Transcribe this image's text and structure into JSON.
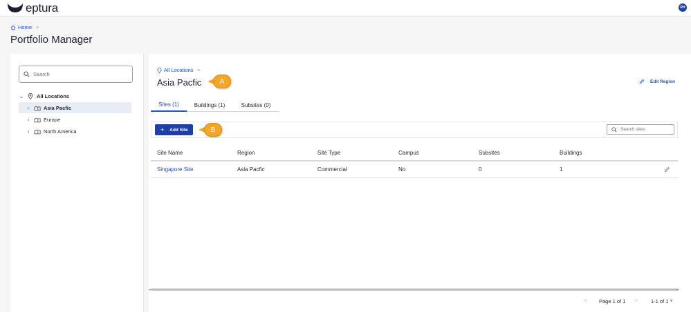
{
  "app": {
    "logo_text": "eptura",
    "avatar_initials": "RH"
  },
  "breadcrumb": {
    "home": "Home",
    "separator": ">"
  },
  "page": {
    "title": "Portfolio Manager"
  },
  "tree": {
    "search_placeholder": "Search",
    "root": "All Locations",
    "items": [
      {
        "label": "Asia Pacfic",
        "selected": true
      },
      {
        "label": "Europe",
        "selected": false
      },
      {
        "label": "North America",
        "selected": false
      }
    ]
  },
  "region": {
    "crumb": "All Locations",
    "title": "Asia Pacfic",
    "edit_label": "Edit Region"
  },
  "callouts": {
    "a": "A",
    "b": "B"
  },
  "tabs": [
    {
      "label": "Sites (1)",
      "active": true
    },
    {
      "label": "Buildings (1)",
      "active": false
    },
    {
      "label": "Subsites (0)",
      "active": false
    }
  ],
  "toolbar": {
    "add_label": "Add Site",
    "add_plus": "+",
    "search_placeholder": "Search sites"
  },
  "table": {
    "columns": [
      "Site Name",
      "Region",
      "Site Type",
      "Campus",
      "Subsites",
      "Buildings"
    ],
    "rows": [
      [
        "Singapore Site",
        "Asia Pacfic",
        "Commercial",
        "No",
        "0",
        "1"
      ]
    ]
  },
  "pagination": {
    "page_label": "Page 1 of 1",
    "range_label": "1-1 of 1",
    "prev": "<",
    "next": ">",
    "range_chevron": "v"
  },
  "colors": {
    "brand": "#1a1f36",
    "accent": "#1e4fd8",
    "button": "#1e3fa6",
    "callout": "#f5a623"
  }
}
